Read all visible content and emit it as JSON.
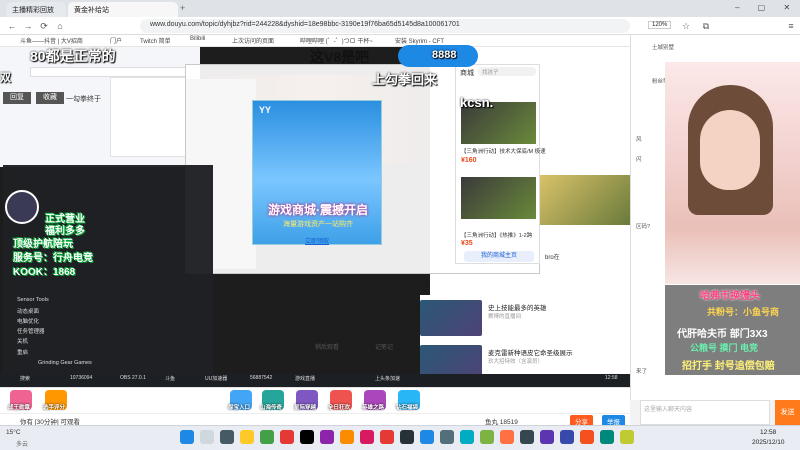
{
  "browser": {
    "tabs": [
      {
        "label": "主播精彩回放"
      },
      {
        "label": "黄金补给站"
      }
    ],
    "url": "www.douyu.com/topic/dyhjbz?rid=244228&dyshid=18e98bbc-3190e19f76ba65d5145d8a100061701",
    "zoom": "120%",
    "bookmarks": [
      "斗鱼——抖音 | 大V招商",
      "门户",
      "Twitch 简单",
      "Bilibili",
      "上次访问的页面",
      "哔哩哔哩 (゜-゜)つロ 干杯~",
      "安装 Skyrim - CFT",
      "上次..."
    ]
  },
  "danmaku": {
    "top_left": "80都是正常的",
    "top_center": "这V8是吧",
    "score": "8888",
    "mid": "上勾拳回来",
    "left_small": "双",
    "recall": "回复",
    "collect": "收藏",
    "jab": "一勾拳终于",
    "ksn": "kcsn."
  },
  "popup": {
    "logo": "YY",
    "title": "游戏商城·震撼开启",
    "subtitle": "海量游戏资产一站购齐",
    "link": "立即领取"
  },
  "side_panel": {
    "header": "商城",
    "search": "找孩子",
    "item1": "【三角洲行动】技术大保底/M 极速",
    "price1": "¥160",
    "item2": "【三角洲行动】《热推》1-2跨",
    "price2": "¥35",
    "join": "我的商城主页",
    "bro": "bro在"
  },
  "start_menu": {
    "items": [
      "Sensor Tools",
      "动态桌面",
      "电脑优化",
      "任务管理器",
      "帮助",
      "关机",
      "重启"
    ],
    "app": "Grinding Gear Games"
  },
  "promo": {
    "line1": "正式营业",
    "line2": "福利多多",
    "line3": "顶级护航陪玩",
    "line4": "服务号：行舟电竞",
    "line5": "KOOK：1868"
  },
  "recommend": [
    {
      "title": "史上技能最多的英雄",
      "meta": "赛博的直播间"
    },
    {
      "title": "麦克雷新种语皮它命圣级展示",
      "meta": "玖大招特效（含演员）"
    }
  ],
  "ctrl": {
    "left": "稍后观看",
    "right": "记笔记"
  },
  "overlay_right": {
    "title": "哈弗币换馒头",
    "sub": "共粉号：小鱼号商",
    "l1": "代肝哈夫币 部门3X3",
    "l2": "公粮号 摸门 电竞",
    "l3": "招打手 封号追偿包赔"
  },
  "right_panel": {
    "rows": [
      "土城别墅",
      "粉丝等级",
      "风",
      "闪",
      "区码?",
      "来了"
    ]
  },
  "gifts": [
    {
      "label": "成王勋章",
      "color": "#f06292"
    },
    {
      "label": "选手评分",
      "color": "#ff9800"
    },
    {
      "label": "探宝入口",
      "color": "#42a5f5"
    },
    {
      "label": "山海传奇",
      "color": "#26a69a"
    },
    {
      "label": "星际穿越",
      "color": "#7e57c2"
    },
    {
      "label": "全日狂欢",
      "color": "#ef5350"
    },
    {
      "label": "英雄之路",
      "color": "#ab47bc"
    },
    {
      "label": "钻石福袋",
      "color": "#29b6f6"
    }
  ],
  "bottom": {
    "left": "你有 [30分钟] 可观看",
    "followers": "鱼丸 18519",
    "share": "分享",
    "report": "举报",
    "chat_placeholder": "这里输入聊天内容",
    "send": "发送"
  },
  "inner_taskbar": [
    "搜索",
    "10736094",
    "Chrome",
    "OBS 27.0.1",
    "斗鱼",
    "UU加速器",
    "游戏直播",
    "56887542",
    "游戏工作室",
    "今日直播",
    "上头条加速"
  ],
  "inner_time": "12:58",
  "taskbar": {
    "weather": "15°C",
    "weather_desc": "多云",
    "time": "12:58",
    "date": "2025/12/10"
  }
}
